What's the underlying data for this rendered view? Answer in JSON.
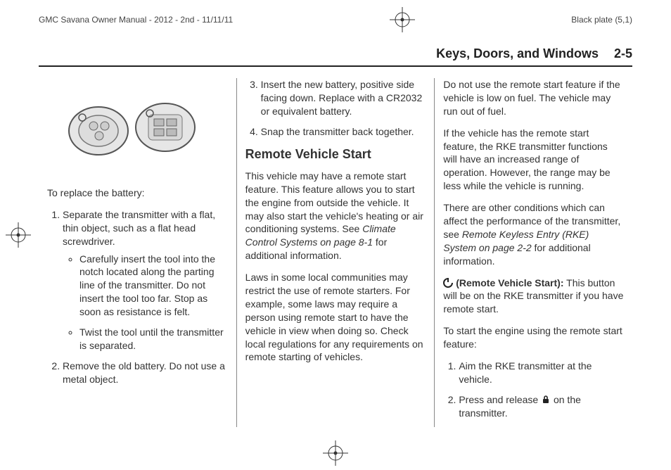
{
  "meta": {
    "manual_title": "GMC Savana Owner Manual - 2012 - 2nd - 11/11/11",
    "plate": "Black plate (5,1)"
  },
  "header": {
    "section": "Keys, Doors, and Windows",
    "page": "2-5"
  },
  "col1": {
    "intro": "To replace the battery:",
    "step1": "Separate the transmitter with a flat, thin object, such as a flat head screwdriver.",
    "bullet1": "Carefully insert the tool into the notch located along the parting line of the transmitter. Do not insert the tool too far. Stop as soon as resistance is felt.",
    "bullet2": "Twist the tool until the transmitter is separated.",
    "step2": "Remove the old battery. Do not use a metal object."
  },
  "col2": {
    "step3": "Insert the new battery, positive side facing down. Replace with a CR2032 or equivalent battery.",
    "step4": "Snap the transmitter back together.",
    "heading": "Remote Vehicle Start",
    "para1_a": "This vehicle may have a remote start feature. This feature allows you to start the engine from outside the vehicle. It may also start the vehicle's heating or air conditioning systems. See ",
    "para1_ref": "Climate Control Systems on page 8-1",
    "para1_b": " for additional information.",
    "para2": "Laws in some local communities may restrict the use of remote starters. For example, some laws may require a person using remote start to have the vehicle in view when doing so. Check local regulations for any requirements on remote starting of vehicles."
  },
  "col3": {
    "para1": "Do not use the remote start feature if the vehicle is low on fuel. The vehicle may run out of fuel.",
    "para2": "If the vehicle has the remote start feature, the RKE transmitter functions will have an increased range of operation. However, the range may be less while the vehicle is running.",
    "para3_a": "There are other conditions which can affect the performance of the transmitter, see ",
    "para3_ref": "Remote Keyless Entry (RKE) System on page 2-2",
    "para3_b": " for additional information.",
    "remote_label": " (Remote Vehicle Start):",
    "remote_body": "  This button will be on the RKE transmitter if you have remote start.",
    "start_intro": "To start the engine using the remote start feature:",
    "start_step1": "Aim the RKE transmitter at the vehicle.",
    "start_step2_a": "Press and release ",
    "start_step2_b": " on the transmitter."
  }
}
